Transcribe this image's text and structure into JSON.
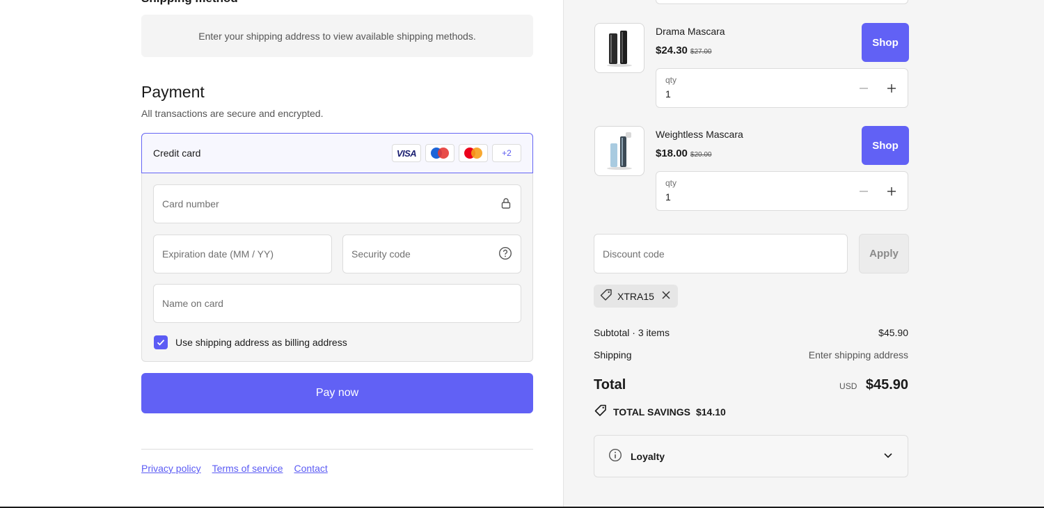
{
  "shipping": {
    "heading": "Shipping method",
    "notice": "Enter your shipping address to view available shipping methods."
  },
  "payment": {
    "title": "Payment",
    "subtitle": "All transactions are secure and encrypted.",
    "method_label": "Credit card",
    "brands": [
      "VISA",
      "Maestro",
      "Mastercard",
      "+2"
    ],
    "fields": {
      "card_number": "Card number",
      "expiry": "Expiration date (MM / YY)",
      "security": "Security code",
      "name": "Name on card"
    },
    "billing_checkbox": {
      "label": "Use shipping address as billing address",
      "checked": true
    },
    "pay_button": "Pay now"
  },
  "footer": {
    "links": [
      "Privacy policy",
      "Terms of service",
      "Contact"
    ]
  },
  "cart": {
    "items": [
      {
        "name": "Drama Mascara",
        "price": "$24.30",
        "original_price": "$27.00",
        "shop_label": "Shop",
        "qty_label": "qty",
        "qty": "1"
      },
      {
        "name": "Weightless Mascara",
        "price": "$18.00",
        "original_price": "$20.00",
        "shop_label": "Shop",
        "qty_label": "qty",
        "qty": "1"
      }
    ],
    "discount": {
      "placeholder": "Discount code",
      "apply_label": "Apply",
      "applied_code": "XTRA15"
    },
    "subtotal_label": "Subtotal · 3 items",
    "subtotal_value": "$45.90",
    "shipping_label": "Shipping",
    "shipping_value": "Enter shipping address",
    "total_label": "Total",
    "total_currency": "USD",
    "total_value": "$45.90",
    "savings_label": "TOTAL SAVINGS",
    "savings_value": "$14.10",
    "loyalty_label": "Loyalty"
  },
  "colors": {
    "accent": "#6161f5",
    "panel": "#f5f5f5"
  },
  "icons": [
    "lock-icon",
    "help-circle-icon",
    "check-icon",
    "minus-icon",
    "plus-icon",
    "tag-icon",
    "close-icon",
    "info-icon",
    "chevron-down-icon"
  ]
}
